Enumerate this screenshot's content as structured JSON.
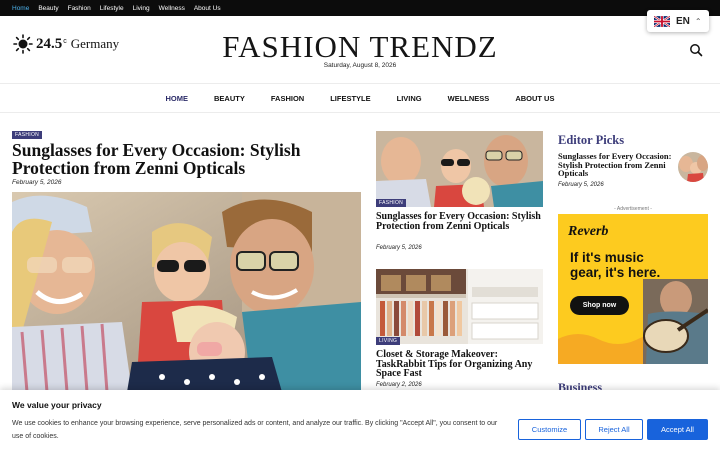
{
  "topbar": {
    "links": [
      "Home",
      "Beauty",
      "Fashion",
      "Lifestyle",
      "Living",
      "Wellness",
      "About Us"
    ],
    "active": "Home"
  },
  "language": {
    "code": "EN",
    "icon": "uk-flag-icon"
  },
  "weather": {
    "temp": "24.5",
    "unit": "c",
    "city": "Germany",
    "icon": "sun-icon"
  },
  "site": {
    "title": "FASHION TRENDZ",
    "date": "Saturday, August 8, 2026"
  },
  "nav": {
    "items": [
      "HOME",
      "BEAUTY",
      "FASHION",
      "LIFESTYLE",
      "LIVING",
      "WELLNESS",
      "ABOUT US"
    ],
    "active": "HOME"
  },
  "featured": {
    "category": "FASHION",
    "title": "Sunglasses for Every Occasion: Stylish Protection from Zenni Opticals",
    "date": "February 5, 2026"
  },
  "middle": [
    {
      "category": "FASHION",
      "title": "Sunglasses for Every Occasion: Stylish Protection from Zenni Opticals",
      "date": "February 5, 2026"
    },
    {
      "category": "LIVING",
      "title": "Closet & Storage Makeover: TaskRabbit Tips for Organizing Any Space Fast",
      "date": "February 2, 2026"
    }
  ],
  "editor_picks": {
    "heading": "Editor Picks",
    "title": "Sunglasses for Every Occasion: Stylish Protection from Zenni Opticals",
    "date": "February 5, 2026"
  },
  "ad": {
    "label": "- Advertisement -",
    "brand": "Reverb",
    "headline": "If it's music gear, it's here.",
    "cta": "Shop now"
  },
  "business_heading": "Business",
  "cookie": {
    "title": "We value your privacy",
    "text": "We use cookies to enhance your browsing experience, serve personalized ads or content, and analyze our traffic. By clicking \"Accept All\", you consent to our use of cookies.",
    "customize": "Customize",
    "reject": "Reject All",
    "accept": "Accept All"
  },
  "colors": {
    "accent": "#3d3d7a",
    "topbar": "#0c0c0c",
    "link_active": "#4db2ec",
    "cookie_blue": "#1863dc",
    "ad_yellow": "#fdcb1f"
  }
}
